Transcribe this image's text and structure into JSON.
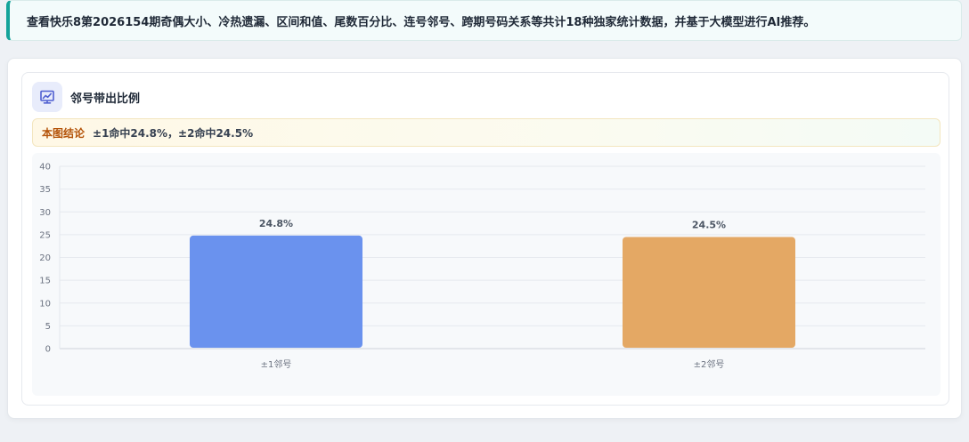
{
  "banner": {
    "text": "查看快乐8第2026154期奇偶大小、冷热遗漏、区间和值、尾数百分比、连号邻号、跨期号码关系等共计18种独家统计数据，并基于大模型进行AI推荐。"
  },
  "card": {
    "title": "邻号带出比例",
    "icon": "chart-line-icon",
    "conclusion_tag": "本图结论",
    "conclusion_text": "±1命中24.8%，±2命中24.5%"
  },
  "colors": {
    "accent_teal": "#14a39a",
    "bar_1": "#6a92ee",
    "bar_2": "#e4a864"
  },
  "chart_data": {
    "type": "bar",
    "categories": [
      "±1邻号",
      "±2邻号"
    ],
    "values": [
      24.8,
      24.5
    ],
    "data_labels": [
      "24.8%",
      "24.5%"
    ],
    "title": "",
    "xlabel": "",
    "ylabel": "",
    "ylim": [
      0,
      40
    ],
    "yticks": [
      0,
      5,
      10,
      15,
      20,
      25,
      30,
      35,
      40
    ],
    "grid": true,
    "legend": "none"
  }
}
